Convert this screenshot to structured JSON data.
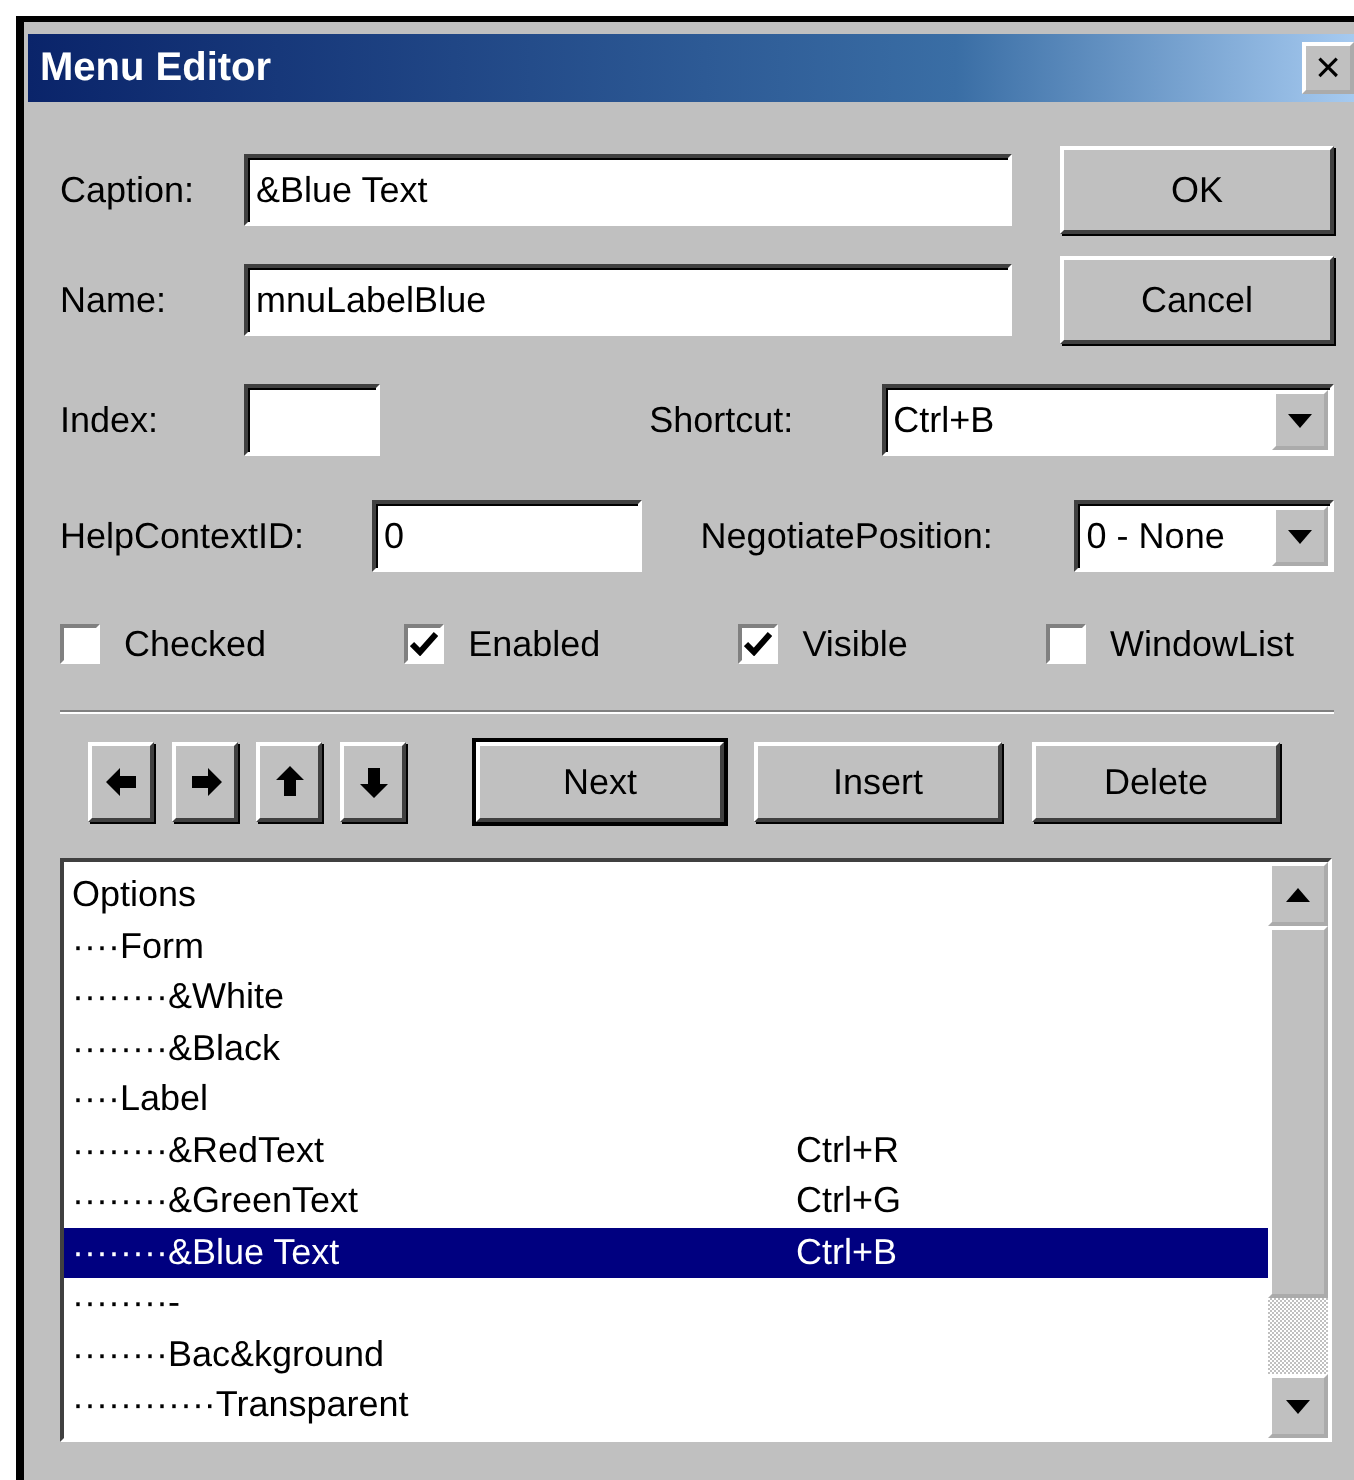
{
  "window": {
    "title": "Menu Editor",
    "close": "×"
  },
  "fields": [
    {
      "label": "Caption:",
      "value": "&Blue Text"
    },
    {
      "label": "Name:",
      "value": "mnuLabelBlue"
    }
  ],
  "buttons": [
    {
      "label": "OK"
    },
    {
      "label": "Cancel"
    }
  ],
  "index": {
    "label": "Index:"
  },
  "shortcut": {
    "label": "Shortcut:",
    "value": "Ctrl+B"
  },
  "help_context_id": {
    "label": "HelpContextID:",
    "value": "0"
  },
  "negotiate_position": {
    "label": "NegotiatePosition:",
    "value": "0 - None"
  },
  "checkboxes": [
    {
      "label": "Checked",
      "checked": false
    },
    {
      "label": "Enabled",
      "checked": true
    },
    {
      "label": "Visible",
      "checked": true
    },
    {
      "label": "WindowList",
      "checked": false
    }
  ],
  "arrows": [
    {
      "kind": "left"
    },
    {
      "kind": "right"
    },
    {
      "kind": "up"
    },
    {
      "kind": "down"
    }
  ],
  "actions": [
    {
      "label": "Next",
      "default": true
    },
    {
      "label": "Insert",
      "default": false
    },
    {
      "label": "Delete",
      "default": false
    }
  ],
  "menu_list": [
    {
      "caption": "Options",
      "selected": false
    },
    {
      "caption": "····Form",
      "selected": false
    },
    {
      "caption": "········&White",
      "selected": false
    },
    {
      "caption": "········&Black",
      "selected": false
    },
    {
      "caption": "····Label",
      "selected": false
    },
    {
      "caption": "········&RedText",
      "shortcut": "Ctrl+R",
      "selected": false
    },
    {
      "caption": "········&GreenText",
      "shortcut": "Ctrl+G",
      "selected": false
    },
    {
      "caption": "········&Blue Text",
      "shortcut": "Ctrl+B",
      "selected": true
    },
    {
      "caption": "········-",
      "selected": false
    },
    {
      "caption": "········Bac&kground",
      "selected": false
    },
    {
      "caption": "············Transparent",
      "selected": false
    }
  ]
}
